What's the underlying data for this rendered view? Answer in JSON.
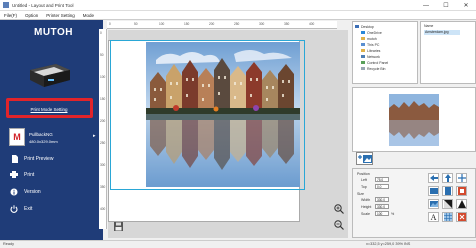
{
  "window": {
    "title": "Untitled - Layout and Print Tool",
    "minimize": "—",
    "maximize": "☐",
    "close": "✕"
  },
  "menu": {
    "items": [
      "File(F)",
      "Option",
      "Printer Setting",
      "Mode"
    ]
  },
  "sidebar": {
    "logo": "MUTOH",
    "print_mode_button": "Print Mode Setting",
    "media_name": "PullbackNG",
    "media_size": "480.0x329.0mm",
    "nav": [
      {
        "label": "Print Preview",
        "icon": "print-preview-icon"
      },
      {
        "label": "Print",
        "icon": "printer-icon"
      },
      {
        "label": "Version",
        "icon": "info-icon"
      },
      {
        "label": "Exit",
        "icon": "power-icon"
      }
    ],
    "colors": {
      "background": "#1f3c78",
      "highlight": "#e2242a"
    }
  },
  "ruler": {
    "top_ticks": [
      "0",
      "50",
      "100",
      "150",
      "200",
      "250",
      "300",
      "350",
      "400"
    ],
    "left_ticks": [
      "0",
      "50",
      "100",
      "150",
      "200",
      "250",
      "300",
      "350",
      "400"
    ]
  },
  "tree": {
    "items": [
      {
        "label": "Desktop",
        "level": 0
      },
      {
        "label": "OneDrive",
        "level": 1
      },
      {
        "label": "mutoh",
        "level": 1
      },
      {
        "label": "This PC",
        "level": 1
      },
      {
        "label": "Libraries",
        "level": 1
      },
      {
        "label": "Network",
        "level": 1
      },
      {
        "label": "Control Panel",
        "level": 1
      },
      {
        "label": "Recycle Bin",
        "level": 1
      }
    ]
  },
  "files": {
    "header": "Name",
    "selected": "Amsterdam.jpg"
  },
  "properties": {
    "position_label": "Position",
    "left_label": "Left",
    "left_value": "75.0",
    "top_label": "Top",
    "top_value": "0.0",
    "size_label": "Size",
    "width_label": "Width",
    "width_value": "330.0",
    "height_label": "Height",
    "height_value": "330.0",
    "scale_label": "Scale",
    "scale_value": "100",
    "unit": "%"
  },
  "status": {
    "left": "Ready",
    "right": "x=332,5 y=259,0    39%    INS"
  }
}
